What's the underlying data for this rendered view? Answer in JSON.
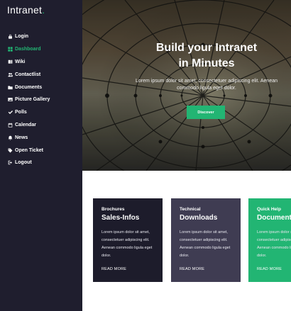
{
  "brand": {
    "name": "Intranet",
    "dot": "."
  },
  "nav": [
    {
      "label": "Login",
      "icon": "lock-icon",
      "active": false
    },
    {
      "label": "Dashboard",
      "icon": "grid-icon",
      "active": true
    },
    {
      "label": "Wiki",
      "icon": "book-icon",
      "active": false
    },
    {
      "label": "Contactlist",
      "icon": "users-icon",
      "active": false
    },
    {
      "label": "Documents",
      "icon": "folder-icon",
      "active": false
    },
    {
      "label": "Picture Gallery",
      "icon": "image-icon",
      "active": false
    },
    {
      "label": "Polls",
      "icon": "check-icon",
      "active": false
    },
    {
      "label": "Calendar",
      "icon": "calendar-icon",
      "active": false
    },
    {
      "label": "News",
      "icon": "bell-icon",
      "active": false
    },
    {
      "label": "Open Ticket",
      "icon": "tag-icon",
      "active": false
    },
    {
      "label": "Logout",
      "icon": "logout-icon",
      "active": false
    }
  ],
  "hero": {
    "title_line1": "Build your Intranet",
    "title_line2": "in Minutes",
    "text": "Lorem ipsum dolor sit amet, consectetuer adipiscing elit. Aenean commodo ligula eget dolor.",
    "button": "Discover"
  },
  "cards": [
    {
      "kicker": "Brochures",
      "heading": "Sales-Infos",
      "body": "Lorem ipsum dolor sit amet, consectetuer adipiscing elit. Aenean commodo ligula eget dolor.",
      "more": "READ MORE"
    },
    {
      "kicker": "Technical",
      "heading": "Downloads",
      "body": "Lorem ipsum dolor sit amet, consectetuer adipiscing elit. Aenean commodo ligula eget dolor.",
      "more": "READ MORE"
    },
    {
      "kicker": "Quick Help",
      "heading": "Documents",
      "body": "Lorem ipsum dolor sit amet, consectetuer adipiscing elit. Aenean commodo ligula eget dolor.",
      "more": "READ MORE"
    }
  ],
  "colors": {
    "sidebar": "#1f1e2e",
    "accent": "#22b573",
    "card1": "#1d1c2b",
    "card2": "#3f3c52",
    "card3": "#22b573"
  }
}
